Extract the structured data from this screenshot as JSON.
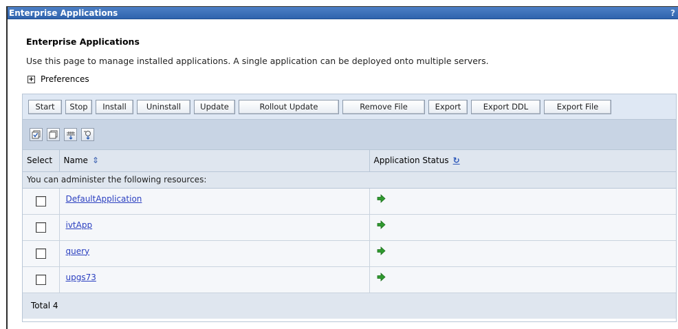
{
  "window": {
    "title": "Enterprise Applications",
    "help": "?"
  },
  "page": {
    "title": "Enterprise Applications",
    "description": "Use this page to manage installed applications. A single application can be deployed onto multiple servers.",
    "preferences_label": "Preferences",
    "preferences_toggle": "+"
  },
  "toolbar": {
    "buttons": [
      "Start",
      "Stop",
      "Install",
      "Uninstall",
      "Update",
      "Rollout Update",
      "Remove File",
      "Export",
      "Export DDL",
      "Export File"
    ]
  },
  "icon_toolbar": {
    "icons": [
      "select-all-icon",
      "deselect-all-icon",
      "show-filter-icon",
      "clear-filter-icon"
    ]
  },
  "table": {
    "headers": {
      "select": "Select",
      "name": "Name",
      "status": "Application Status"
    },
    "message": "You can administer the following resources:",
    "rows": [
      {
        "name": "DefaultApplication",
        "status_icon": "started-arrow-icon",
        "checked": false
      },
      {
        "name": "ivtApp",
        "status_icon": "started-arrow-icon",
        "checked": false
      },
      {
        "name": "query",
        "status_icon": "started-arrow-icon",
        "checked": false
      },
      {
        "name": "upgs73",
        "status_icon": "started-arrow-icon",
        "checked": false
      }
    ],
    "total": "Total 4"
  },
  "colors": {
    "title_bar": "#3a6db8",
    "table_header": "#dfe6ef",
    "link": "#2a3fc0",
    "status_green": "#2f9a2f"
  }
}
